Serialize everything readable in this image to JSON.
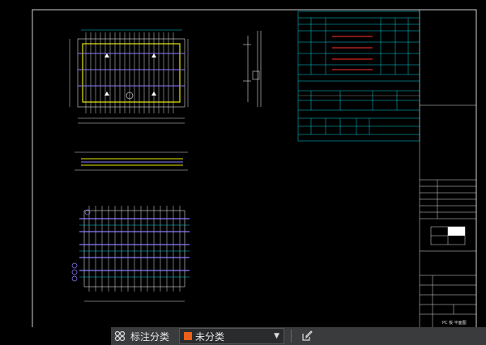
{
  "toolbar": {
    "category_label": "标注分类",
    "category_value": "未分类",
    "swatch_color": "#e8601c"
  },
  "drawing": {
    "background": "#000000",
    "line_color": "#ffffff",
    "cyan_color": "#00d0e0",
    "yellow_color": "#e8e800",
    "purple_color": "#8a7bff",
    "title_block_text": "PC 板 平面图"
  }
}
